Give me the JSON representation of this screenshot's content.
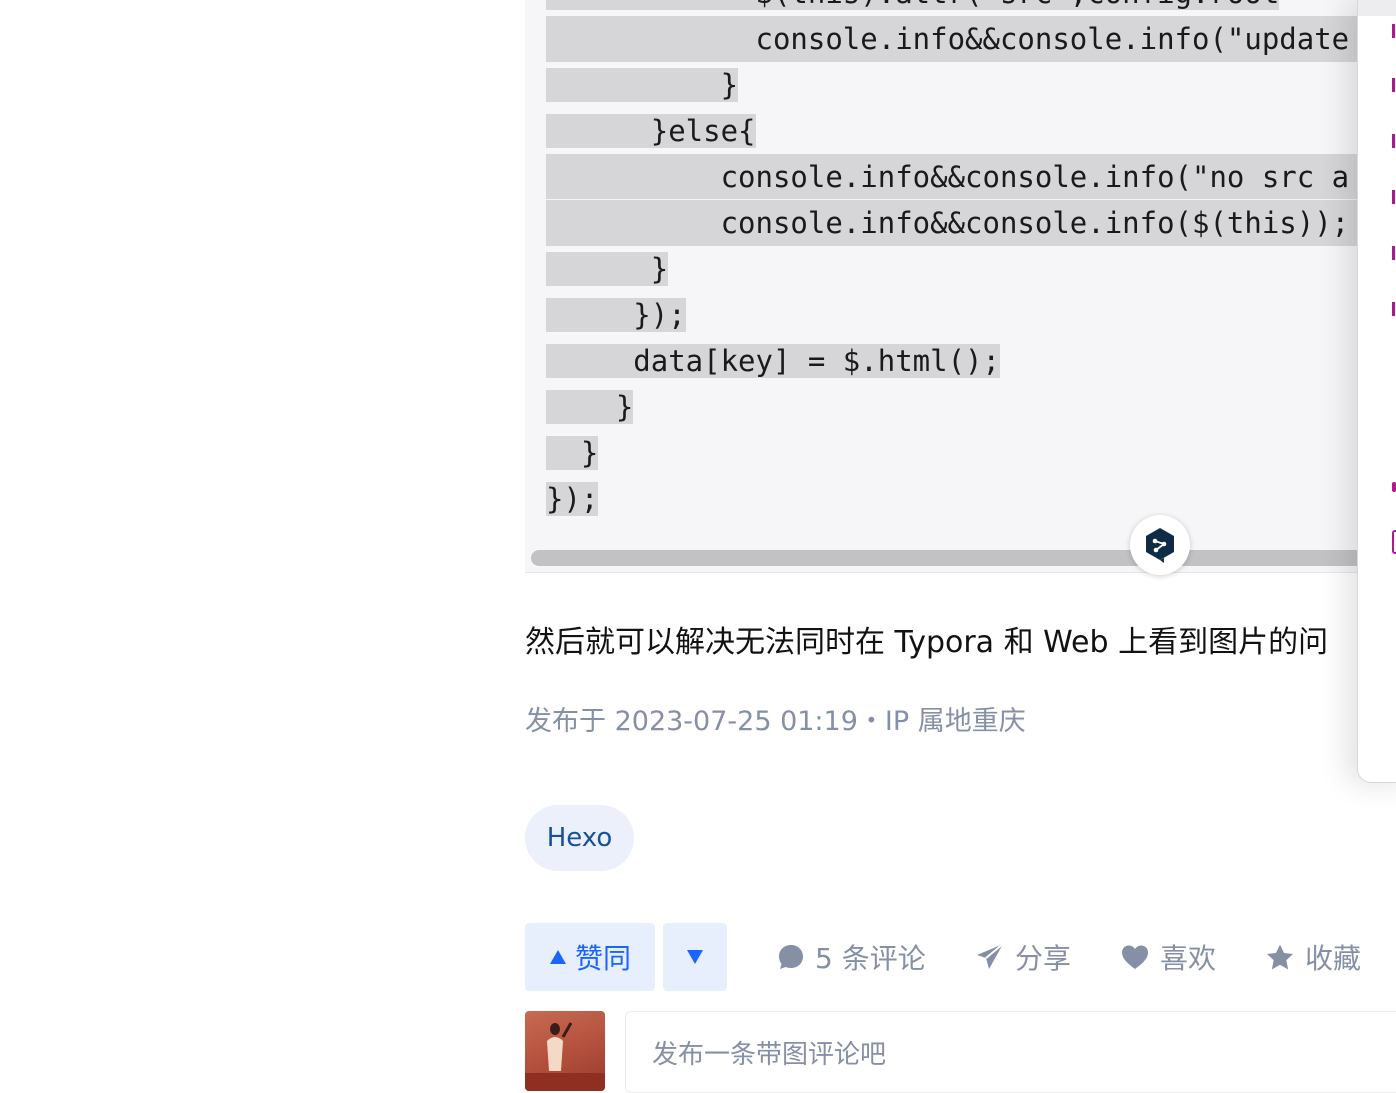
{
  "code": {
    "lines": [
      "            $(this).attr(\"src\",config.root",
      "            console.info&&console.info(\"update",
      "          }",
      "      }else{",
      "          console.info&&console.info(\"no src a",
      "          console.info&&console.info($(this));",
      "      }",
      "     });",
      "     data[key] = $.html();",
      "    }",
      "  }",
      "});"
    ]
  },
  "article": {
    "summary": "然后就可以解决无法同时在 Typora 和 Web 上看到图片的问",
    "meta": "发布于 2023-07-25 01:19・IP 属地重庆",
    "tag": "Hexo"
  },
  "actions": {
    "upvote_label": "赞同",
    "comments_label": "5 条评论",
    "share_label": "分享",
    "like_label": "喜欢",
    "favorite_label": "收藏"
  },
  "comment": {
    "placeholder": "发布一条带图评论吧"
  },
  "colors": {
    "accent": "#1966ff",
    "meta_gray": "#8590a6",
    "code_highlight": "#d6d6d8",
    "tag_bg": "#ebf0fb"
  }
}
